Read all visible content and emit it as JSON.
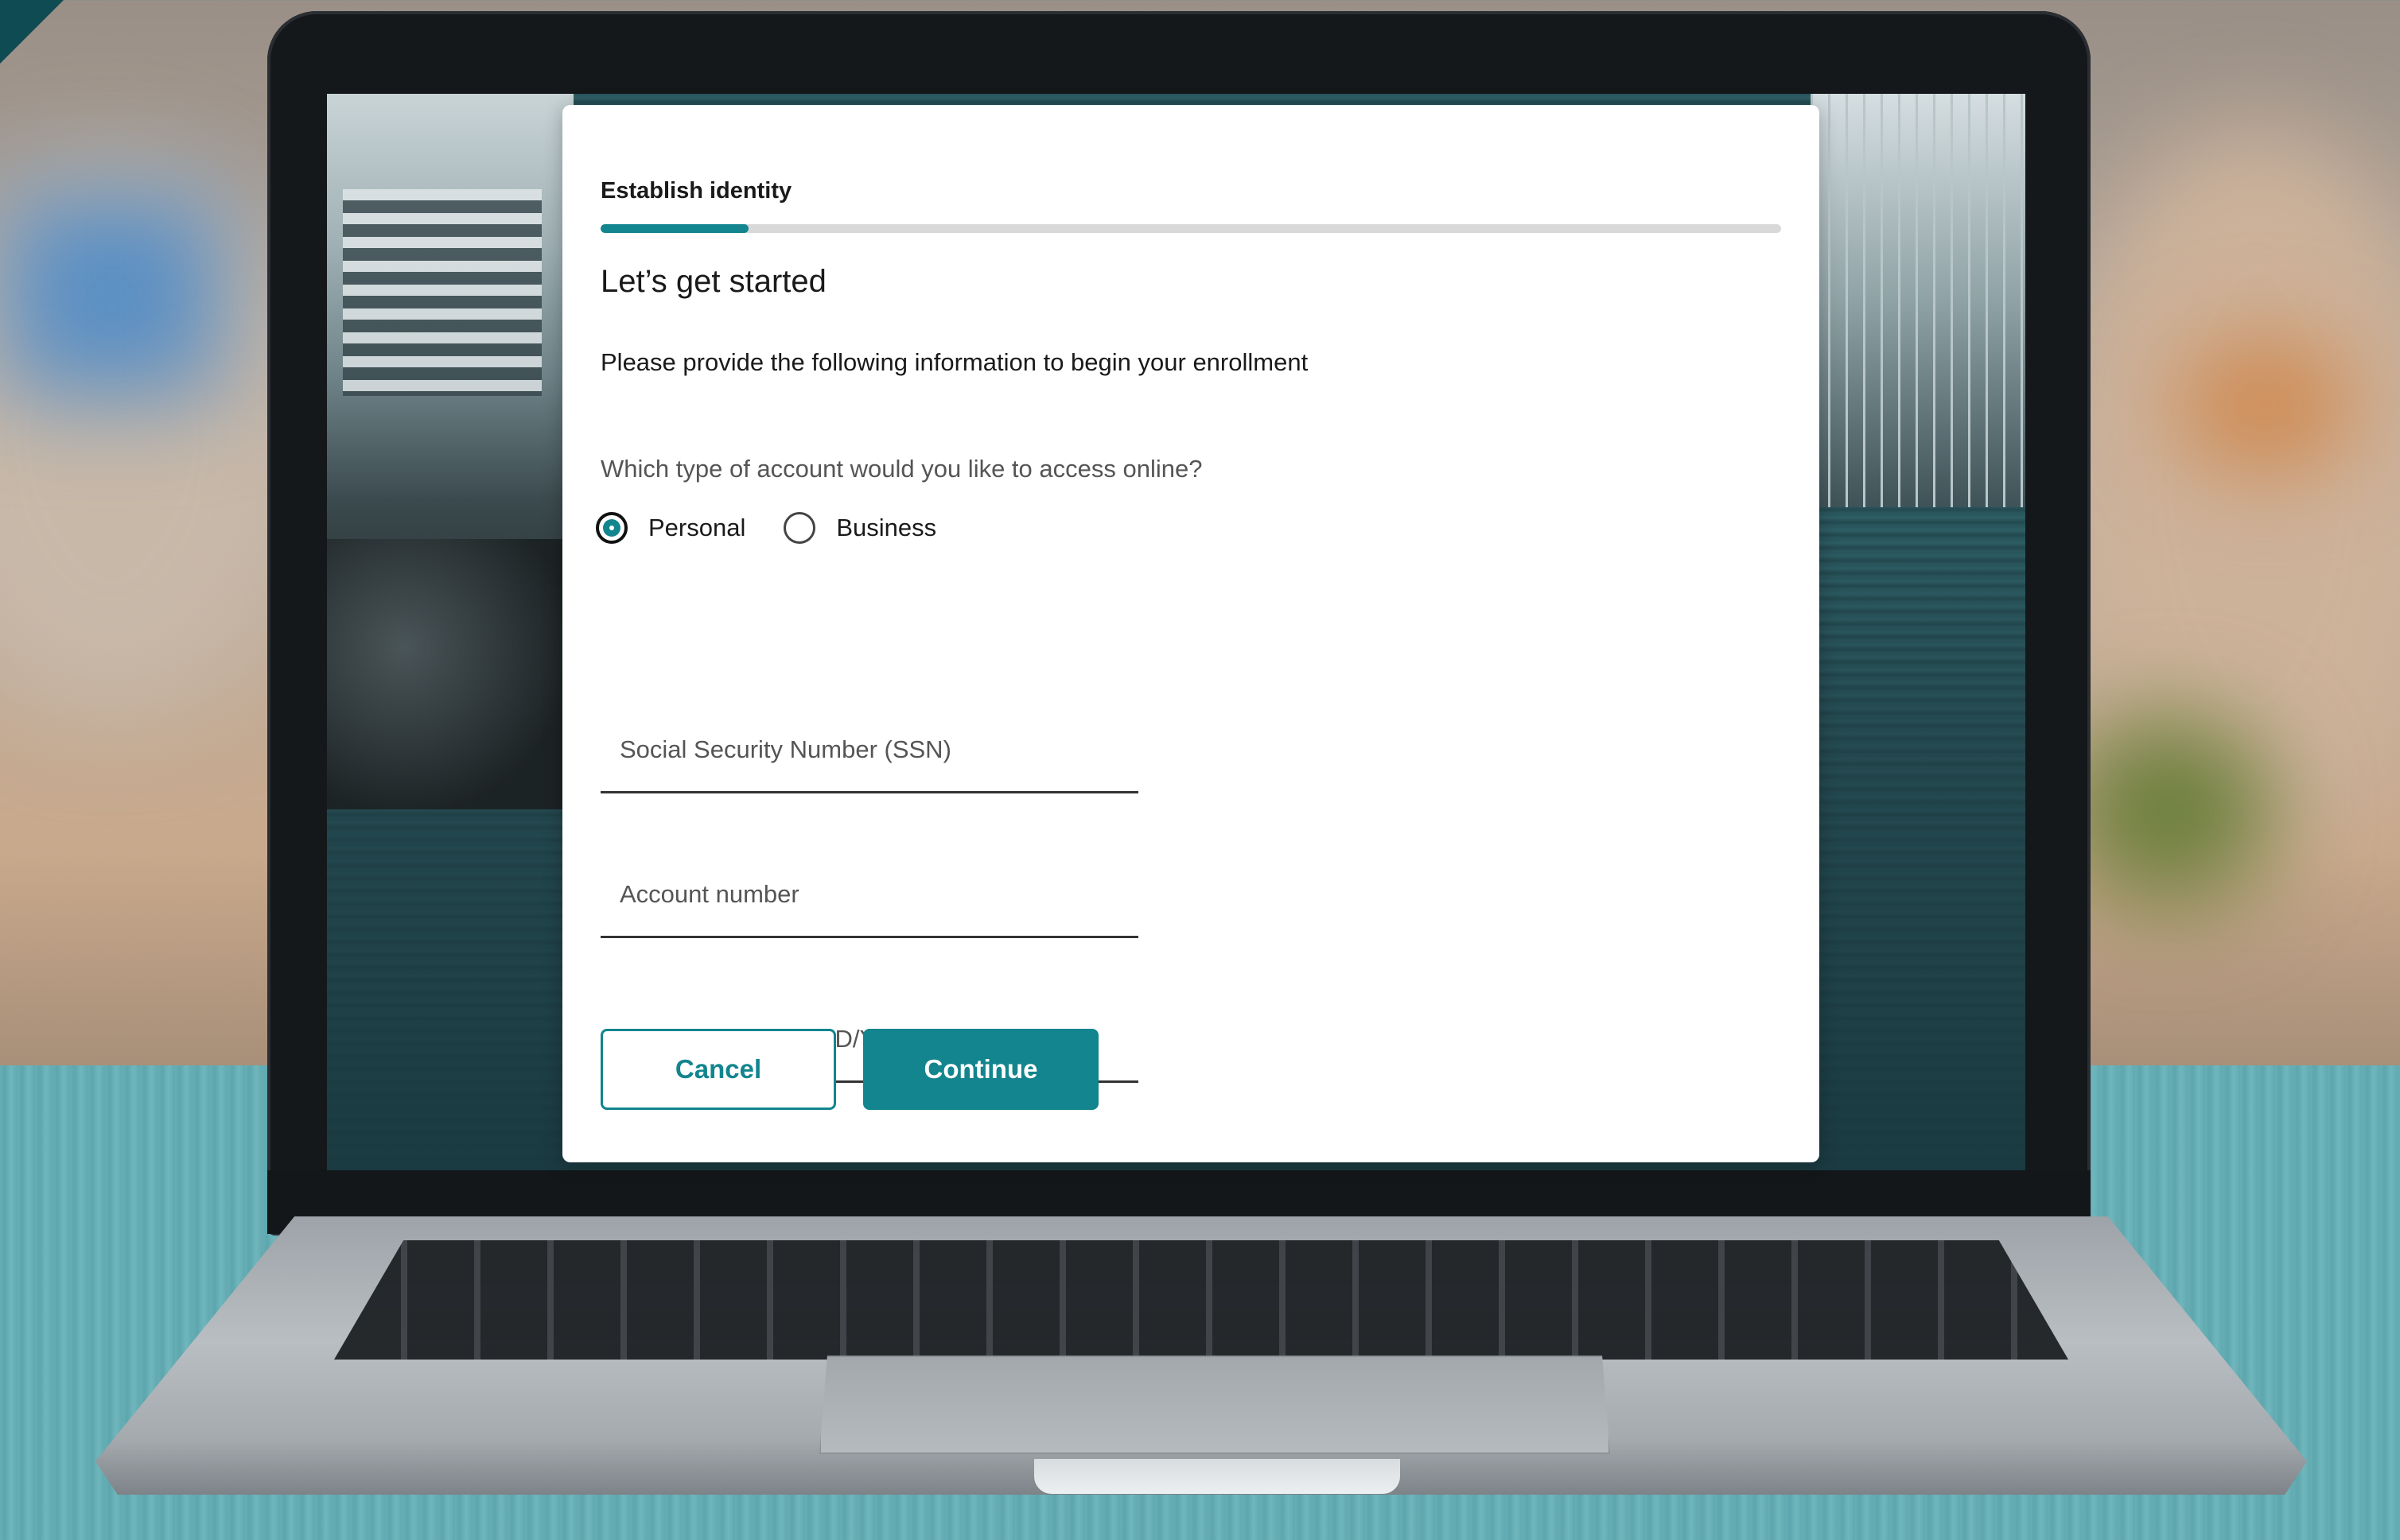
{
  "enrollment": {
    "step_label": "Establish identity",
    "progress": 0.125,
    "title": "Let’s get started",
    "subtitle": "Please provide the following information to begin your enrollment",
    "account_question": "Which type of account would you like to access online?",
    "account_types": [
      {
        "label": "Personal",
        "selected": true
      },
      {
        "label": "Business",
        "selected": false
      }
    ],
    "fields": {
      "ssn_placeholder": "Social Security Number (SSN)",
      "account_placeholder": "Account number",
      "dob_placeholder": "Date of birth (MM/DD/YYYY)"
    },
    "buttons": {
      "cancel": "Cancel",
      "continue": "Continue"
    }
  },
  "colors": {
    "accent": "#12858e",
    "text": "#1a1a1a",
    "track": "#d9d9d9"
  }
}
